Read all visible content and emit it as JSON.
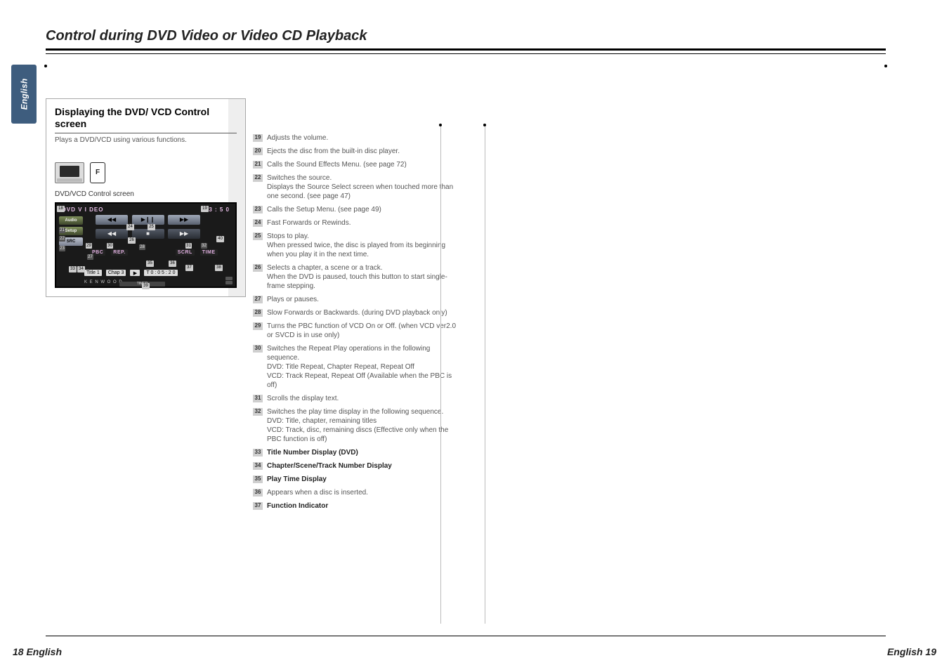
{
  "header": {
    "title": "Control during DVD Video or Video CD Playback"
  },
  "sideTab": {
    "language": "English"
  },
  "section": {
    "title": "Displaying the DVD/ VCD Control screen",
    "subtitle": "Plays a DVD/VCD using various functions.",
    "f_label": "F",
    "screen_label": "DVD/VCD Control screen"
  },
  "dvd": {
    "title": "DVD  V I DEO",
    "clock": "1 3 : 5 0",
    "audio": "Audio",
    "setup": "Setup",
    "src": "SRC",
    "pbc": "PBC",
    "rep": "REP.",
    "scrl": "SCRL",
    "time": "TIME",
    "title_box": "Title 1",
    "chap_box": "Chap     3",
    "play_sym": "▶",
    "t_play": "T 0 : 0 5 : 2 0",
    "brand": "K E N W O O D",
    "timer": "TIMER",
    "btns": {
      "prev": "◀◀",
      "play": "▶❙❙",
      "next": "▶▶",
      "stop": "■",
      "skip_b": "◀◀",
      "skip_f": "▶▶"
    },
    "m": {
      "m18": "18",
      "m19": "19",
      "m20": "40",
      "m24": "24",
      "m25": "25",
      "m26": "26",
      "m29": "29",
      "m30": "30",
      "m31": "31",
      "m33": "33",
      "m34": "34",
      "m35": "35",
      "m36": "36",
      "m37": "37",
      "m38": "38",
      "m39": "39",
      "m40": "40",
      "m21": "21",
      "m22": "22",
      "m23": "23",
      "m27": "27",
      "m28": "28",
      "m32": "32"
    }
  },
  "descriptions": [
    {
      "num": "19",
      "text": "Adjusts the volume."
    },
    {
      "num": "20",
      "text": "Ejects the disc from the built-in disc player."
    },
    {
      "num": "21",
      "text": "Calls the Sound Effects Menu. (see page 72)"
    },
    {
      "num": "22",
      "text": "Switches the source.\nDisplays the Source Select screen when touched more than one second. (see page 47)"
    },
    {
      "num": "23",
      "text": "Calls the Setup Menu. (see page 49)"
    },
    {
      "num": "24",
      "text": "Fast Forwards or Rewinds."
    },
    {
      "num": "25",
      "text": "Stops to play.\nWhen pressed twice, the disc is played from its beginning when you play it in the next time."
    },
    {
      "num": "26",
      "text": "Selects a chapter, a scene or a track.\nWhen the DVD is paused, touch this button to start single-frame stepping."
    },
    {
      "num": "27",
      "text": "Plays or pauses."
    },
    {
      "num": "28",
      "text": "Slow Forwards or Backwards. (during DVD playback only)"
    },
    {
      "num": "29",
      "text": "Turns the PBC function of VCD On or Off. (when VCD ver2.0 or SVCD is in use only)"
    },
    {
      "num": "30",
      "text": "Switches the Repeat Play operations in the following sequence.\nDVD: Title Repeat, Chapter Repeat, Repeat Off\nVCD: Track Repeat, Repeat Off (Available when the PBC is off)"
    },
    {
      "num": "31",
      "text": "Scrolls the display text."
    },
    {
      "num": "32",
      "text": "Switches the play time display in the following sequence.\nDVD: Title, chapter, remaining titles\nVCD: Track, disc, remaining discs (Effective only when the PBC function is off)"
    },
    {
      "num": "33",
      "text": "Title Number Display (DVD)",
      "bold": true
    },
    {
      "num": "34",
      "text": "Chapter/Scene/Track Number Display",
      "bold": true
    },
    {
      "num": "35",
      "text": "Play Time Display",
      "bold": true
    },
    {
      "num": "36",
      "text": "Appears when a disc is inserted."
    },
    {
      "num": "37",
      "text": "Function Indicator",
      "bold": true
    }
  ],
  "footer": {
    "left": "18 English",
    "right": "English 19"
  }
}
